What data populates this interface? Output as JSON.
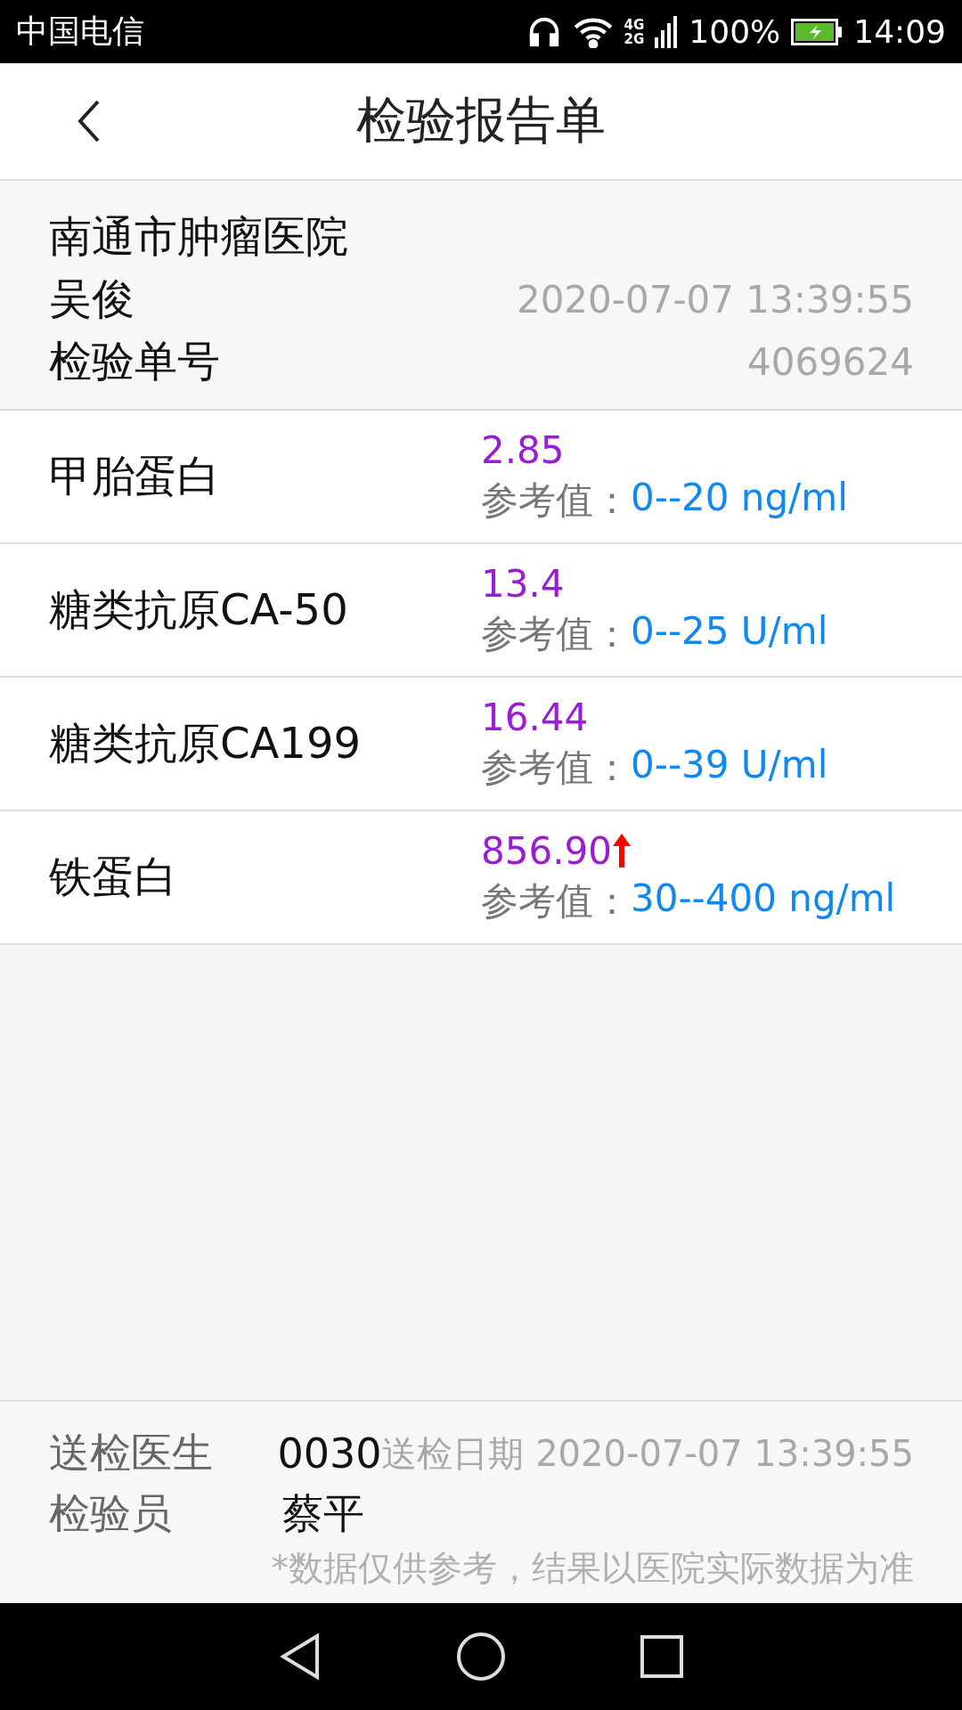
{
  "status_bar": {
    "carrier": "中国电信",
    "network_top": "4G",
    "network_bottom": "2G",
    "battery": "100%",
    "time": "14:09"
  },
  "header": {
    "title": "检验报告单"
  },
  "info": {
    "hospital": "南通市肿瘤医院",
    "patient": "吴俊",
    "datetime": "2020-07-07 13:39:55",
    "order_label": "检验单号",
    "order_number": "4069624"
  },
  "results": [
    {
      "name": "甲胎蛋白",
      "value": "2.85",
      "high": false,
      "ref_label": "参考值：",
      "ref_range": "0--20 ng/ml"
    },
    {
      "name": "糖类抗原CA-50",
      "value": "13.4",
      "high": false,
      "ref_label": "参考值：",
      "ref_range": "0--25 U/ml"
    },
    {
      "name": "糖类抗原CA199",
      "value": "16.44",
      "high": false,
      "ref_label": "参考值：",
      "ref_range": "0--39 U/ml"
    },
    {
      "name": "铁蛋白",
      "value": "856.90",
      "high": true,
      "ref_label": "参考值：",
      "ref_range": "30--400 ng/ml"
    }
  ],
  "footer": {
    "doctor_label": "送检医生",
    "doctor": "0030",
    "date_label": "送检日期",
    "date": "2020-07-07 13:39:55",
    "inspector_label": "检验员",
    "inspector": "蔡平",
    "disclaimer": "*数据仅供参考，结果以医院实际数据为准"
  }
}
